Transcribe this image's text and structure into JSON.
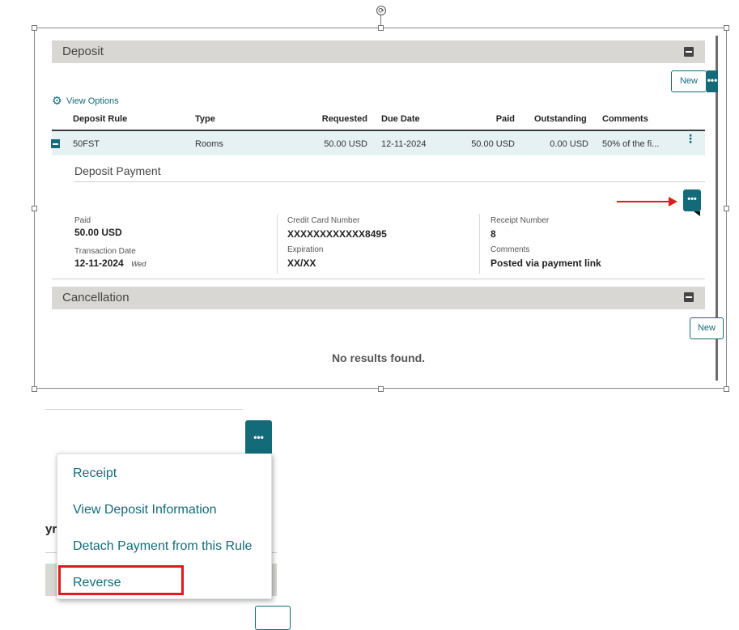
{
  "deposit": {
    "section_title": "Deposit",
    "new_label": "New",
    "view_options_label": "View Options",
    "columns": [
      "Deposit Rule",
      "Type",
      "Requested",
      "Due Date",
      "Paid",
      "Outstanding",
      "Comments"
    ],
    "row": {
      "rule": "50FST",
      "type": "Rooms",
      "requested": "50.00 USD",
      "due_date": "12-11-2024",
      "paid": "50.00 USD",
      "outstanding": "0.00 USD",
      "comments": "50% of the fi..."
    }
  },
  "deposit_payment": {
    "title": "Deposit Payment",
    "paid_label": "Paid",
    "paid_value": "50.00 USD",
    "transaction_date_label": "Transaction Date",
    "transaction_date_value": "12-11-2024",
    "transaction_day": "Wed",
    "card_label": "Credit Card Number",
    "card_value": "XXXXXXXXXXXX8495",
    "expiration_label": "Expiration",
    "expiration_value": "XX/XX",
    "receipt_label": "Receipt Number",
    "receipt_value": "8",
    "comments_label": "Comments",
    "comments_value": "Posted via payment link"
  },
  "cancellation": {
    "section_title": "Cancellation",
    "new_label": "New",
    "empty_text": "No results found."
  },
  "context_menu": {
    "items": [
      "Receipt",
      "View Deposit Information",
      "Detach Payment from this Rule",
      "Reverse"
    ]
  },
  "icons": {
    "dots": "•••",
    "kebab": "⋮",
    "gear": "⚙",
    "rotate": "⟳"
  },
  "background_fragment": "yr",
  "colors": {
    "accent": "#136b7a",
    "highlight": "#e01b1b",
    "header_bg": "#d9d7d3",
    "row_bg": "#e6f1f3"
  }
}
